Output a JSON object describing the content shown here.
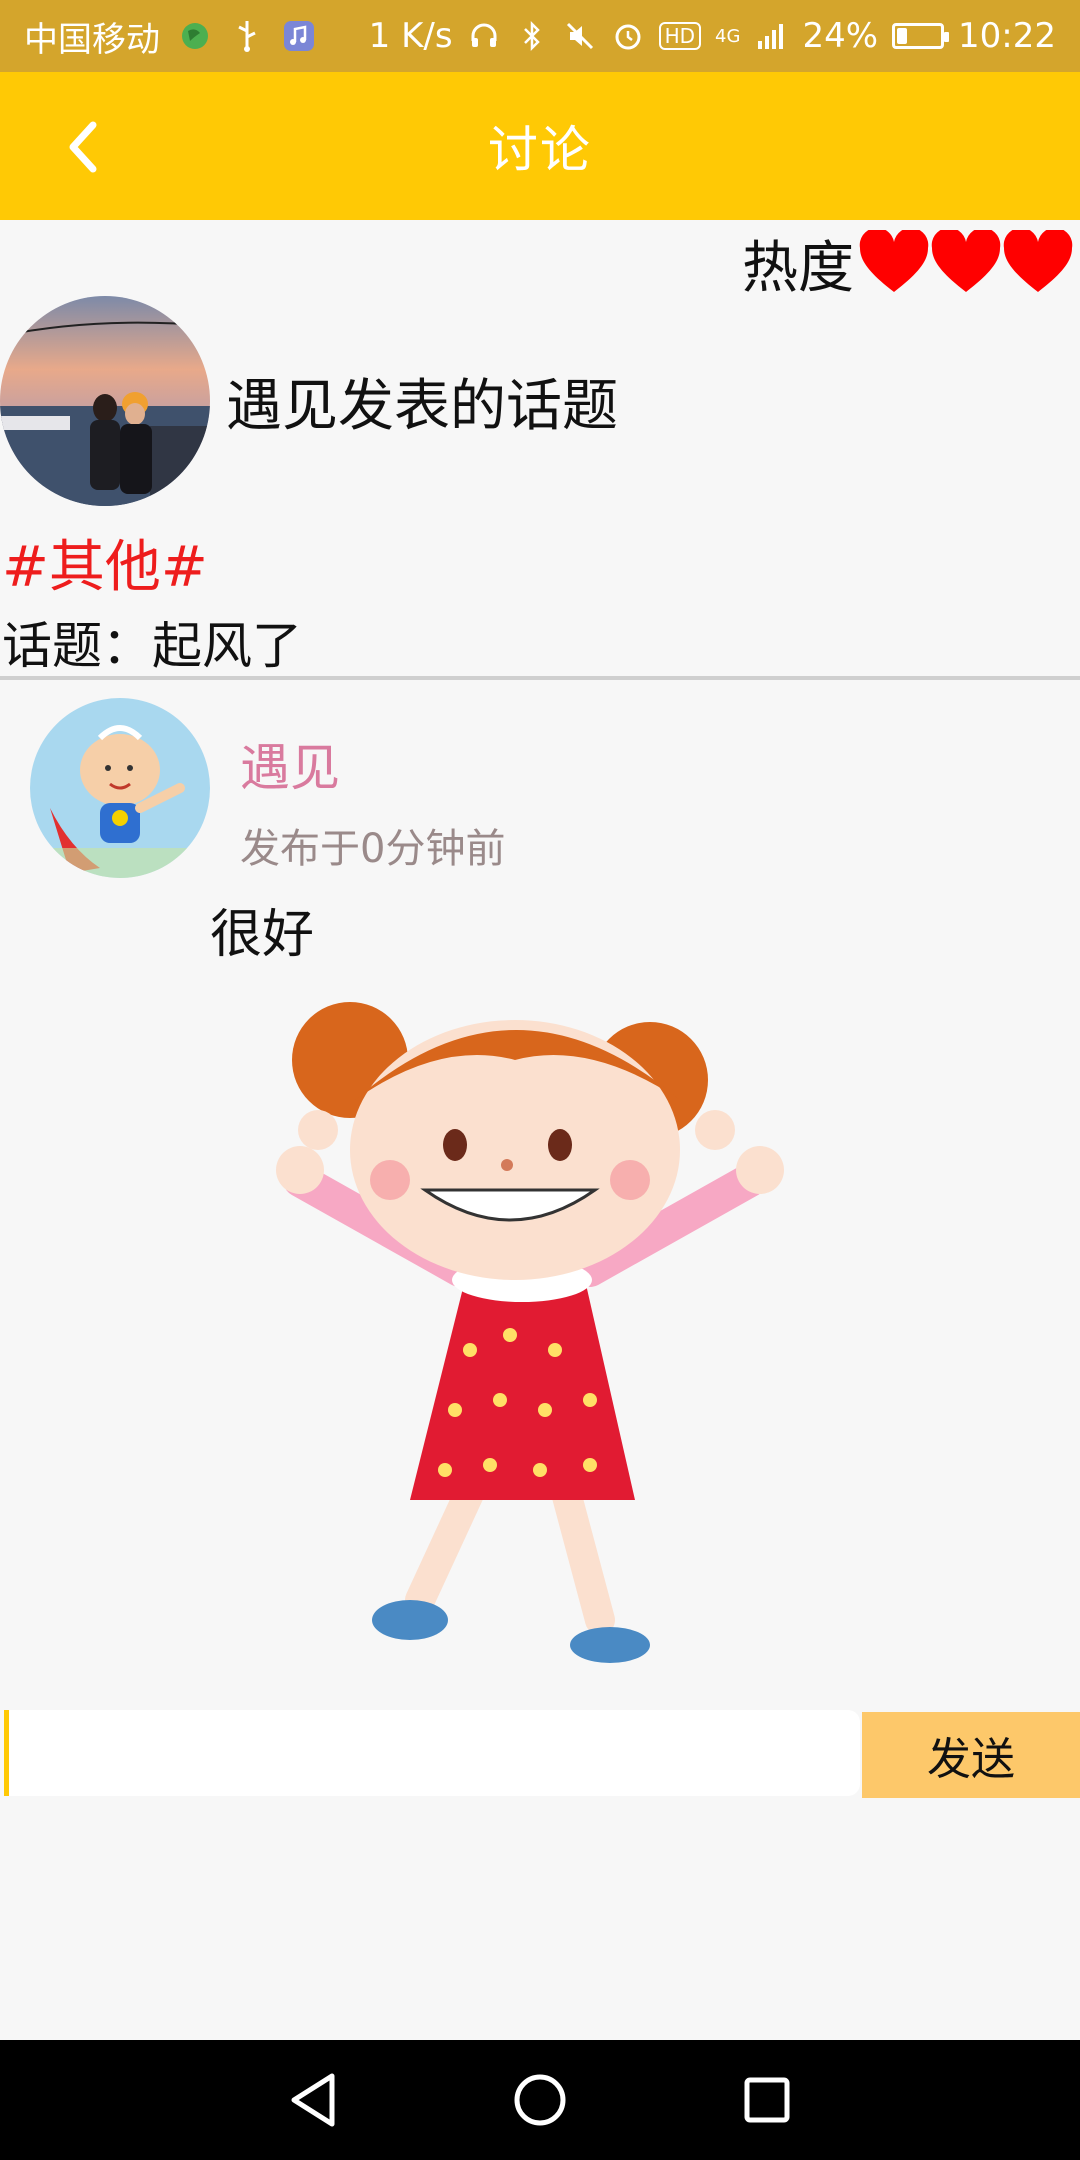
{
  "status_bar": {
    "carrier": "中国移动",
    "speed": "1 K/s",
    "hd_badge": "HD",
    "network": "4G",
    "battery_percent": "24%",
    "battery_level": 0.24,
    "time": "10:22",
    "icons": [
      "globe-icon",
      "usb-icon",
      "music-icon",
      "headphones-icon",
      "bluetooth-icon",
      "mute-icon",
      "alarm-icon",
      "signal-icon",
      "battery-icon"
    ]
  },
  "app_bar": {
    "title": "讨论",
    "back_icon": "chevron-left-icon"
  },
  "post": {
    "heat_label": "热度",
    "heat_hearts": 3,
    "heading": "遇见发表的话题",
    "tag": "#其他#",
    "topic_label": "话题：",
    "topic_text": "起风了"
  },
  "comment": {
    "author": "遇见",
    "time": "发布于0分钟前",
    "text": "很好"
  },
  "composer": {
    "input_value": "",
    "send_label": "发送"
  },
  "nav": {
    "buttons": [
      "back-triangle-icon",
      "home-circle-icon",
      "recents-square-icon"
    ]
  },
  "colors": {
    "status_bar": "#d4a52c",
    "app_bar": "#ffc905",
    "heart": "#ff0000",
    "tag": "#ee1d1d",
    "author_name": "#d97a9e",
    "send_button": "#fdc86a"
  }
}
